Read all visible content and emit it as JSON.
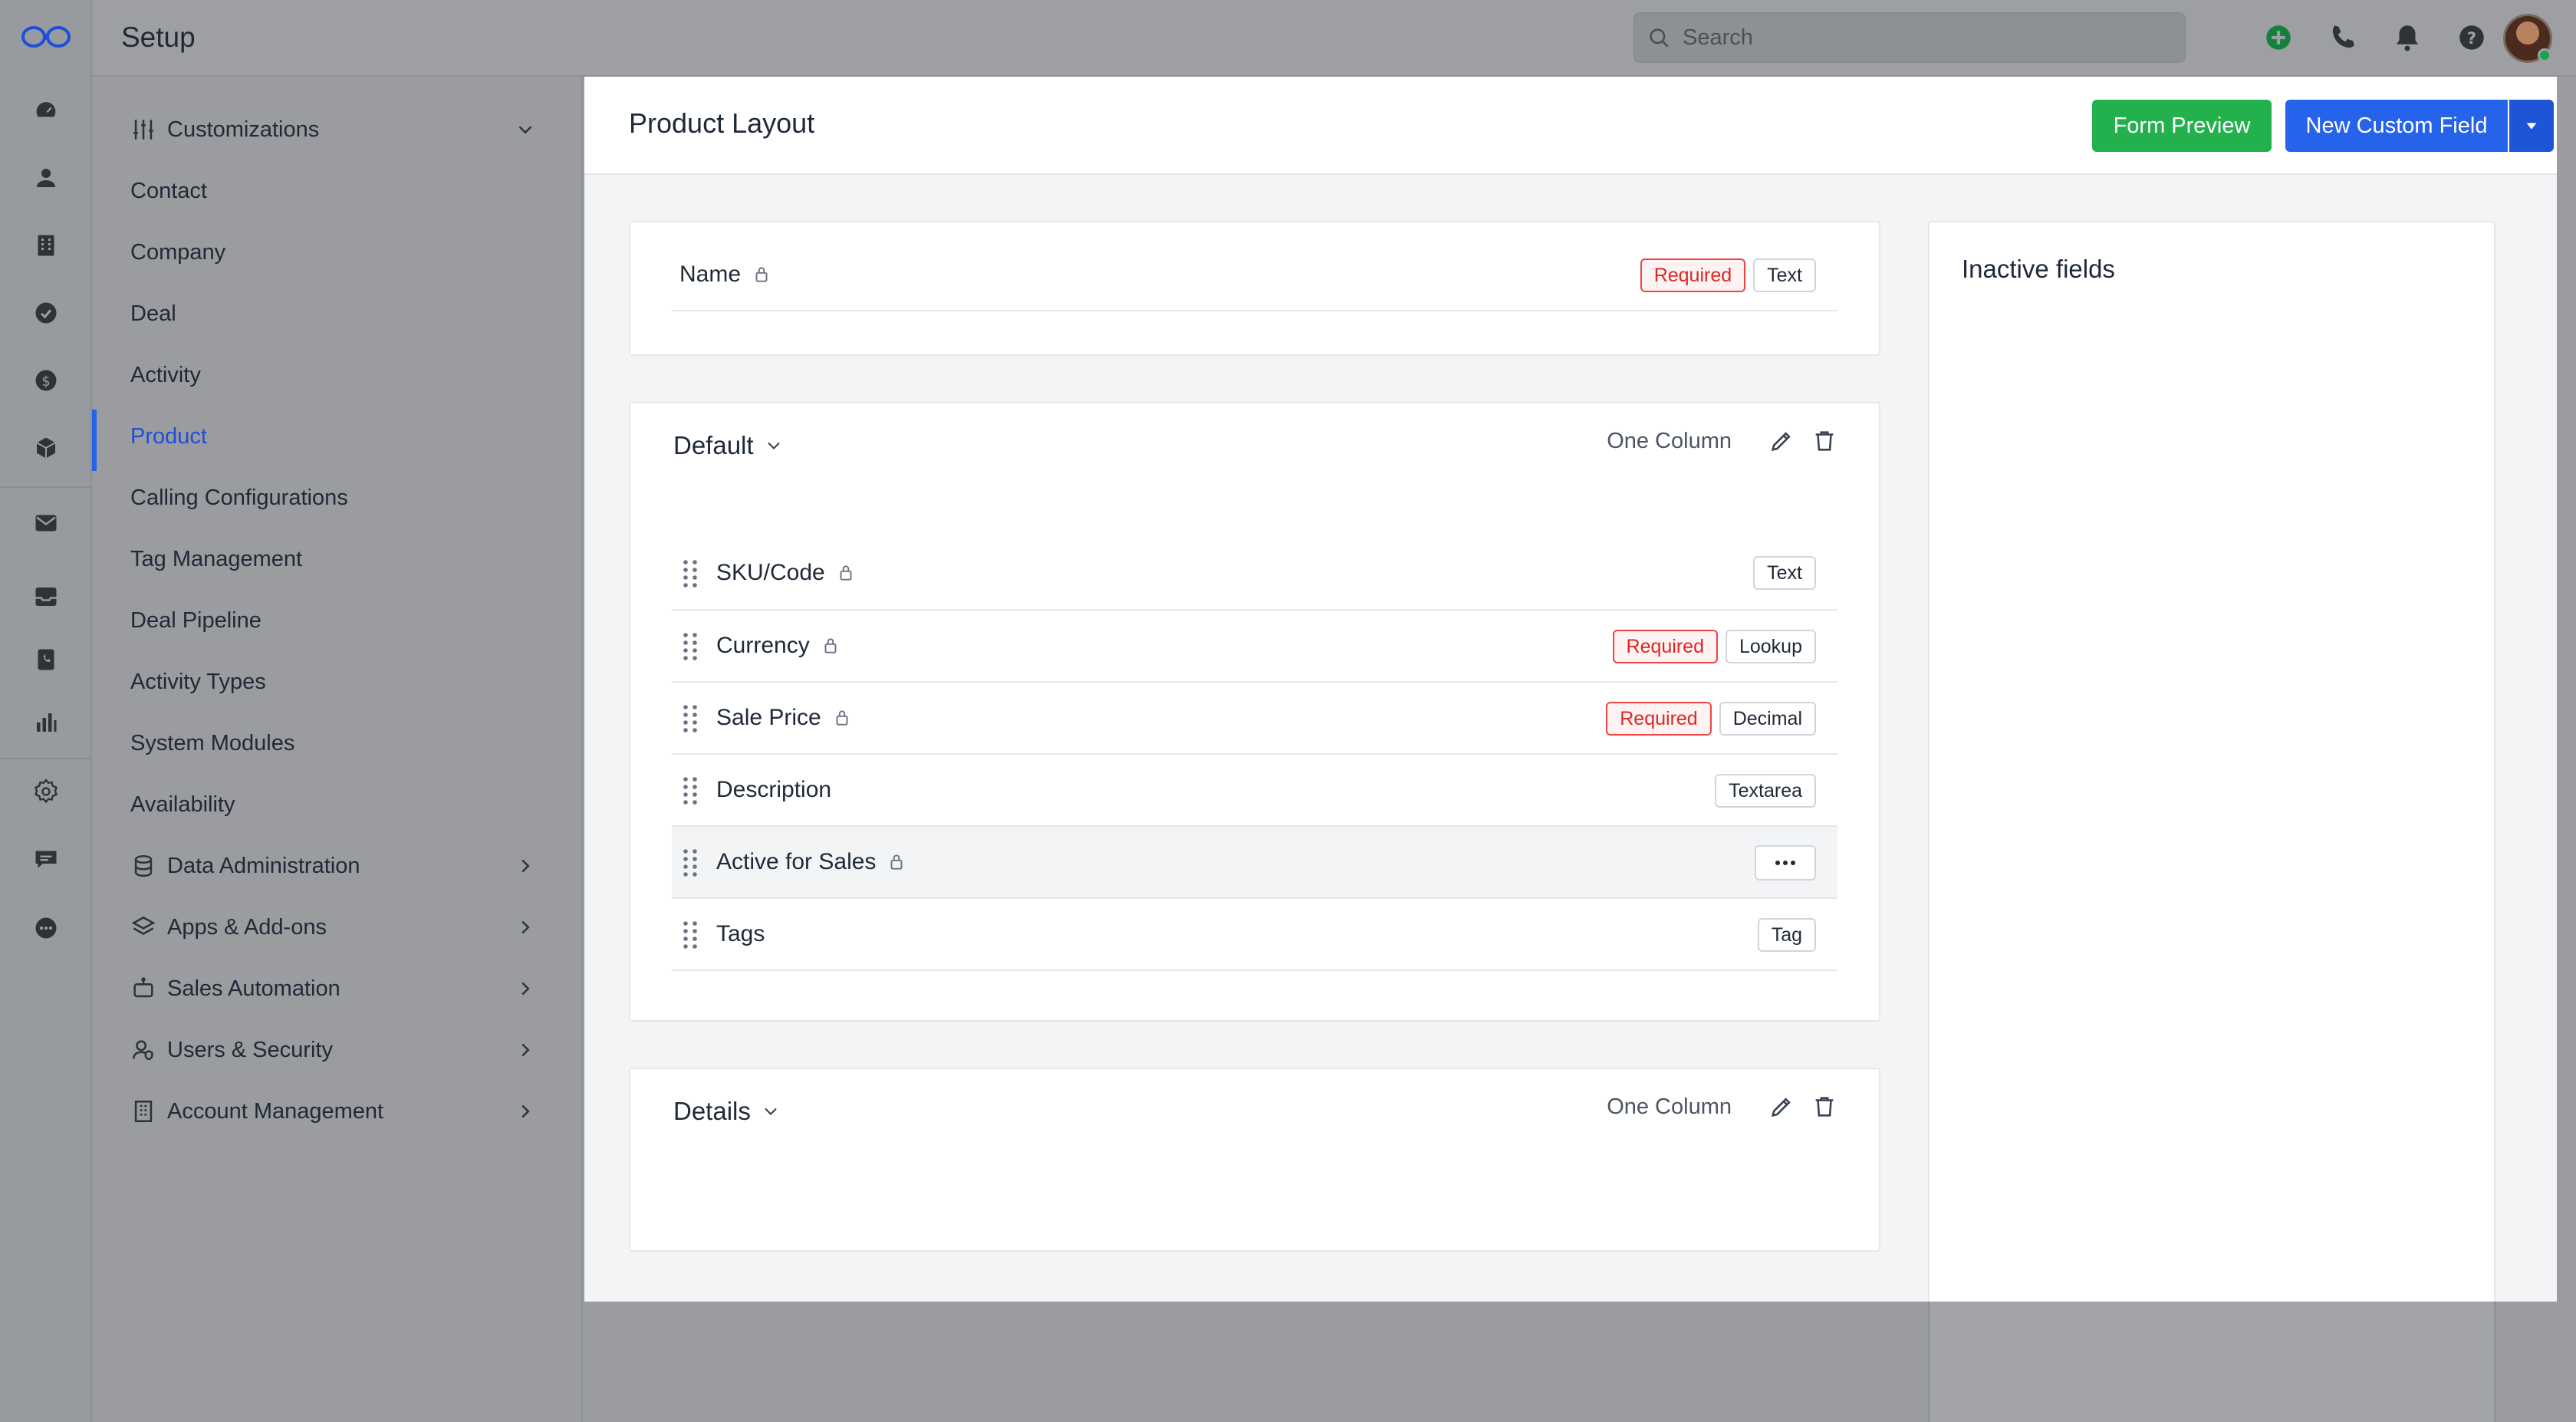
{
  "app": {
    "title": "Setup"
  },
  "search": {
    "placeholder": "Search",
    "value": ""
  },
  "sidebar": {
    "customizations": "Customizations",
    "items": [
      "Contact",
      "Company",
      "Deal",
      "Activity",
      "Product",
      "Calling Configurations",
      "Tag Management",
      "Deal Pipeline",
      "Activity Types",
      "System Modules",
      "Availability"
    ],
    "active": "Product",
    "groups": [
      "Data Administration",
      "Apps & Add-ons",
      "Sales Automation",
      "Users & Security",
      "Account Management"
    ]
  },
  "page": {
    "title": "Product Layout",
    "form_preview": "Form Preview",
    "new_custom_field": "New Custom Field"
  },
  "name_field": {
    "label": "Name",
    "badges": [
      "Required",
      "Text"
    ]
  },
  "default_section": {
    "title": "Default",
    "columns": "One Column",
    "fields": [
      {
        "label": "SKU/Code",
        "badges": [
          "Text"
        ]
      },
      {
        "label": "Currency",
        "badges": [
          "Required",
          "Lookup"
        ]
      },
      {
        "label": "Sale Price",
        "badges": [
          "Required",
          "Decimal"
        ]
      },
      {
        "label": "Description",
        "badges": [
          "Textarea"
        ]
      },
      {
        "label": "Active for Sales",
        "badges": []
      },
      {
        "label": "Tags",
        "badges": [
          "Tag"
        ]
      }
    ]
  },
  "details_section": {
    "title": "Details",
    "columns": "One Column"
  },
  "inactive": {
    "title": "Inactive fields"
  },
  "colors": {
    "primary": "#2563eb",
    "success": "#22b14c",
    "required": "#dc2626"
  }
}
